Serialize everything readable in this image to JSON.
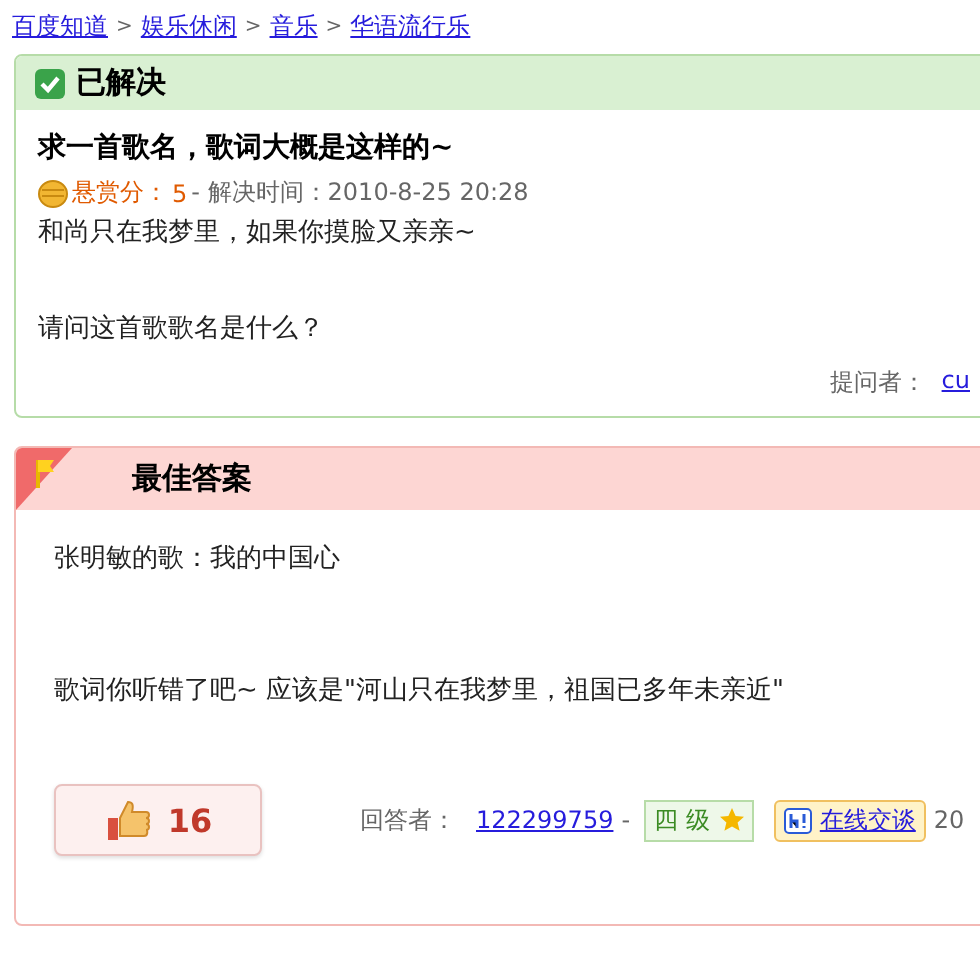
{
  "breadcrumb": [
    "百度知道",
    "娱乐休闲",
    "音乐",
    "华语流行乐"
  ],
  "breadcrumb_separator": ">",
  "question": {
    "status": "已解决",
    "solved": true,
    "title": "求一首歌名，歌词大概是这样的~",
    "reward_label": "悬赏分：",
    "reward": "5",
    "solved_time": "- 解决时间：2010-8-25 20:28",
    "body": [
      "和尚只在我梦里，如果你摸脸又亲亲~",
      "请问这首歌歌名是什么？"
    ],
    "asker_label": "提问者：",
    "asker": "cu"
  },
  "best_answer": {
    "title": "最佳答案",
    "body": [
      "张明敏的歌：我的中国心",
      "歌词你听错了吧~  应该是\"河山只在我梦里，祖国已多年未亲近\""
    ],
    "likes": "16",
    "answerer_label": "回答者：",
    "answerer": "122299759",
    "dash": "-",
    "level": "四 级",
    "chat": "在线交谈",
    "date": "20"
  }
}
